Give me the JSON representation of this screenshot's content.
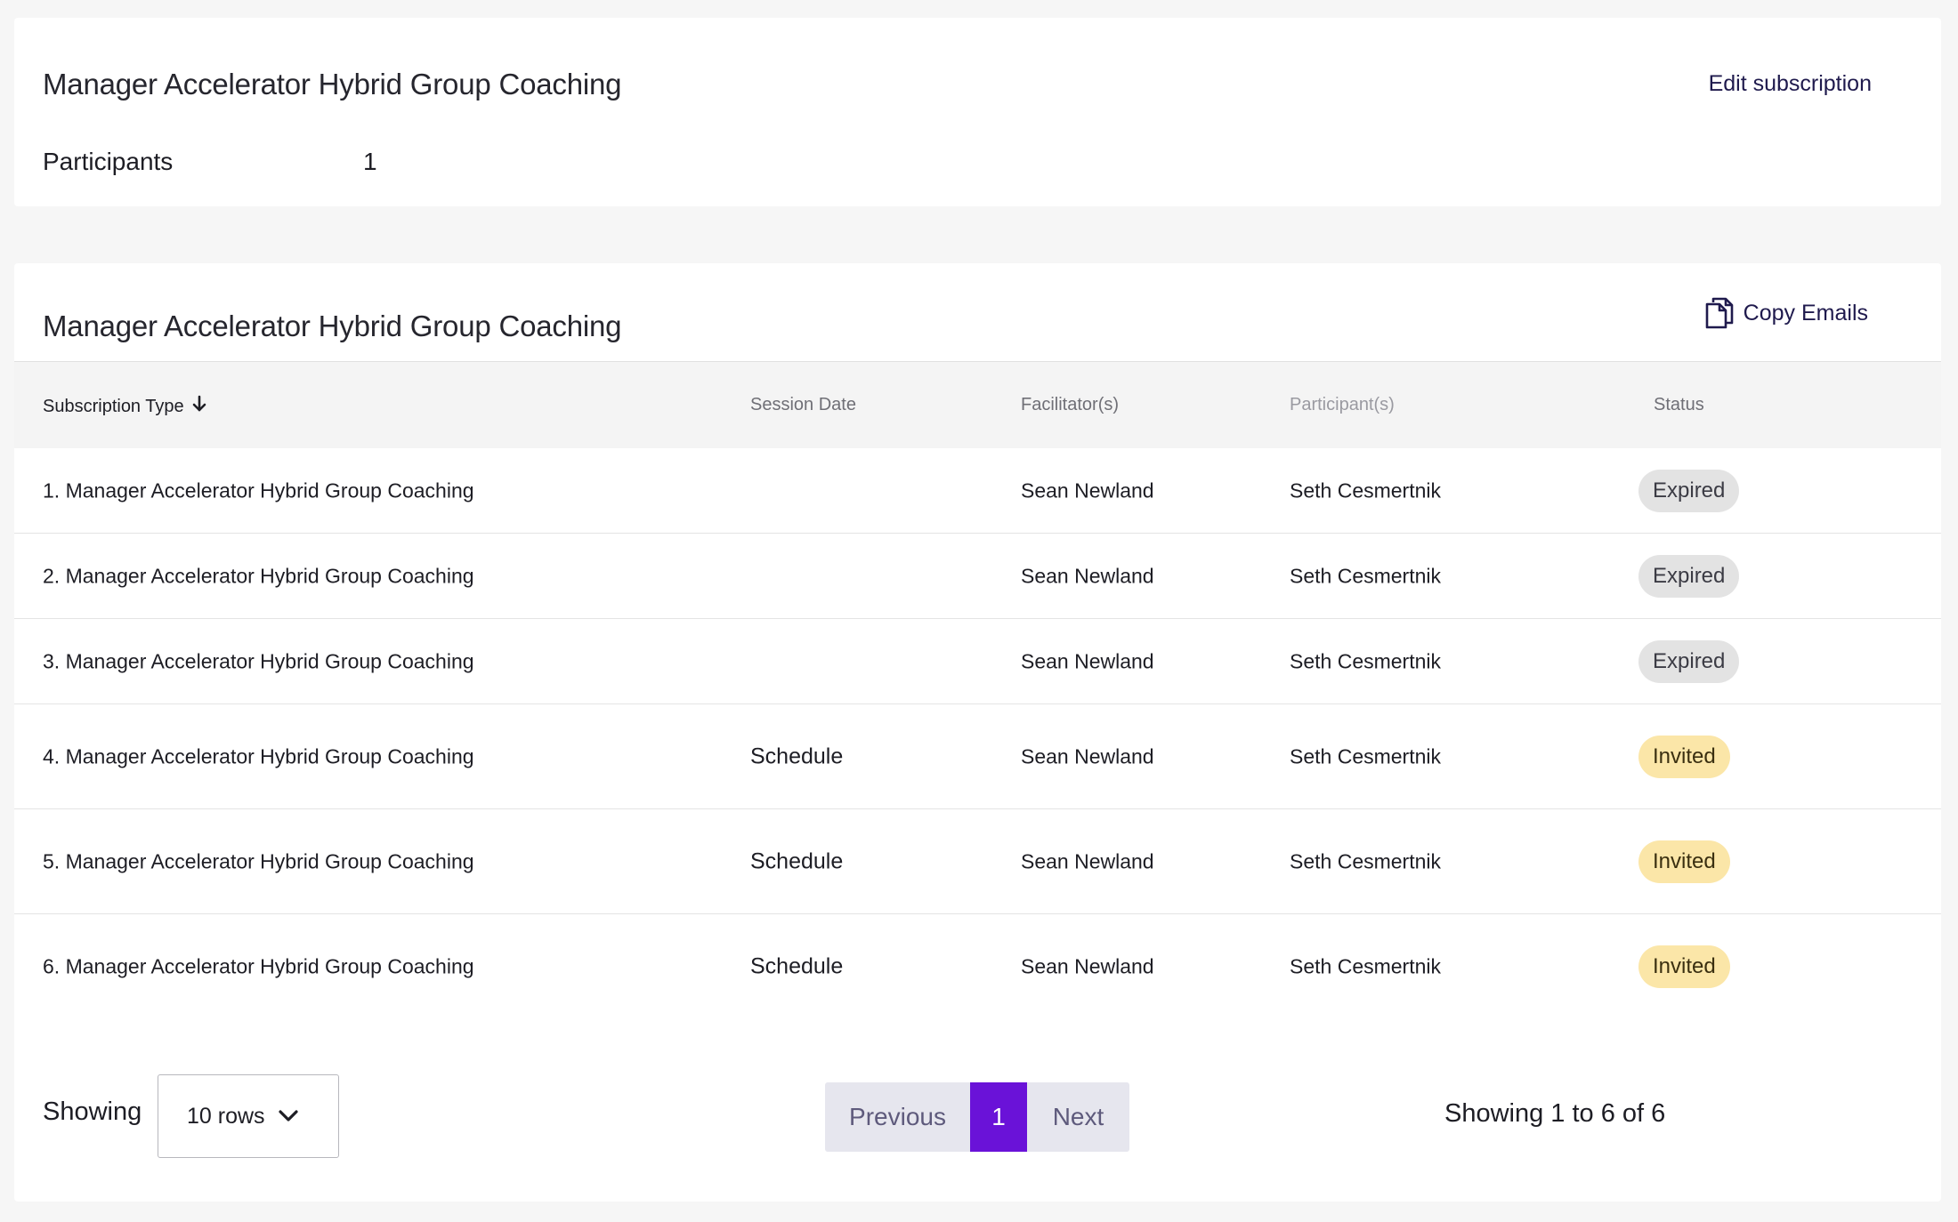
{
  "summary_card": {
    "title": "Manager Accelerator Hybrid Group Coaching",
    "edit_label": "Edit subscription",
    "participants_label": "Participants",
    "participants_value": "1"
  },
  "sessions_card": {
    "title": "Manager Accelerator Hybrid Group Coaching",
    "copy_emails_label": "Copy Emails",
    "columns": {
      "type": "Subscription Type",
      "date": "Session Date",
      "facilitators": "Facilitator(s)",
      "participants": "Participant(s)",
      "status": "Status"
    },
    "rows": [
      {
        "type": "1. Manager Accelerator Hybrid Group Coaching",
        "date": "",
        "facilitator": "Sean Newland",
        "participant": "Seth Cesmertnik",
        "status": "Expired"
      },
      {
        "type": "2. Manager Accelerator Hybrid Group Coaching",
        "date": "",
        "facilitator": "Sean Newland",
        "participant": "Seth Cesmertnik",
        "status": "Expired"
      },
      {
        "type": "3. Manager Accelerator Hybrid Group Coaching",
        "date": "",
        "facilitator": "Sean Newland",
        "participant": "Seth Cesmertnik",
        "status": "Expired"
      },
      {
        "type": "4. Manager Accelerator Hybrid Group Coaching",
        "date": "Schedule",
        "facilitator": "Sean Newland",
        "participant": "Seth Cesmertnik",
        "status": "Invited"
      },
      {
        "type": "5. Manager Accelerator Hybrid Group Coaching",
        "date": "Schedule",
        "facilitator": "Sean Newland",
        "participant": "Seth Cesmertnik",
        "status": "Invited"
      },
      {
        "type": "6. Manager Accelerator Hybrid Group Coaching",
        "date": "Schedule",
        "facilitator": "Sean Newland",
        "participant": "Seth Cesmertnik",
        "status": "Invited"
      }
    ]
  },
  "footer": {
    "showing_label": "Showing",
    "rows_select_value": "10 rows",
    "prev_label": "Previous",
    "current_page": "1",
    "next_label": "Next",
    "summary": "Showing 1 to 6 of 6"
  },
  "colors": {
    "accent": "#6a12d8",
    "expired_badge": "#e3e3e3",
    "invited_badge": "#fbe6a8",
    "link": "#1f1a4d"
  },
  "icons": {
    "sort": "arrow-down-icon",
    "copy": "copy-icon",
    "select": "chevron-down-icon"
  }
}
